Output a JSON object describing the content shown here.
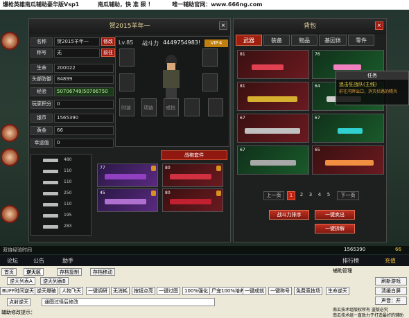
{
  "titlebar": {
    "app": "爆枪英雄南瓜辅助豪华版Vsp1",
    "slogan": "南瓜辅助，快 准 狠 ！",
    "site": "唯一辅助官网：www.666ng.com"
  },
  "character": {
    "title": "贺2015羊年一",
    "level": "Lv.85",
    "power_label": "战斗力",
    "power": "4449754983!",
    "vip": "VIP.4",
    "suit_button": "战袍套件",
    "stats": [
      {
        "label": "名称",
        "value": "贺2015羊年一",
        "action": "修改"
      },
      {
        "label": "称号",
        "value": "无",
        "action": "前往"
      },
      {
        "label": "生命",
        "value": "200022"
      },
      {
        "label": "头部防御",
        "value": "84899"
      },
      {
        "label": "经验",
        "value": "50706749/50706750"
      },
      {
        "label": "玩家积分",
        "value": "0"
      },
      {
        "label": "银币",
        "value": "1565390"
      },
      {
        "label": "黄金",
        "value": "66"
      },
      {
        "label": "幸运值",
        "value": "0"
      }
    ],
    "slot_labels": [
      "时装",
      "项链",
      "戒指"
    ],
    "weapon_counts": [
      "480",
      "110",
      "110",
      "250",
      "110",
      "195",
      "283"
    ],
    "weapons": [
      {
        "level": "77",
        "color": "purple"
      },
      {
        "level": "80",
        "color": "red"
      },
      {
        "level": "45",
        "color": "purple"
      },
      {
        "level": "80",
        "color": "red"
      }
    ]
  },
  "bag": {
    "title": "背包",
    "tabs": [
      "武器",
      "装备",
      "物品",
      "基因体",
      "零件"
    ],
    "active_tab": "武器",
    "items": [
      {
        "level": "81",
        "color": "red"
      },
      {
        "level": "76",
        "color": "green"
      },
      {
        "level": "81",
        "color": "red"
      },
      {
        "level": "64",
        "color": "green"
      },
      {
        "level": "67",
        "color": "red"
      },
      {
        "level": "67",
        "color": "green"
      },
      {
        "level": "67",
        "color": "green"
      },
      {
        "level": "65",
        "color": "red"
      }
    ],
    "prev": "上一页",
    "next": "下一页",
    "pages": [
      "1",
      "2",
      "3",
      "4",
      "5"
    ],
    "current_page": "1",
    "sort_button": "战斗力排序",
    "sell_button": "一键卖出",
    "dismantle_button": "一键拆解"
  },
  "task": {
    "title": "任务",
    "quest": "追击狂战队(主线)",
    "desc": "前往河畔出口，消灭拦路的精兵"
  },
  "hud": {
    "exp_label": "双倍经验时间",
    "silver": "1565390",
    "gold": "66",
    "nav": [
      "论坛",
      "公告",
      "助手",
      "排行榜",
      "充值"
    ]
  },
  "toolbar": {
    "tabs_row1": [
      "首页",
      "逆天区",
      "存档复制",
      "存档移动"
    ],
    "active_tab": "逆天区",
    "tabs_row2": [
      "逆天列表A",
      "逆天列表B"
    ],
    "buttons": [
      "BUFF时间逆天",
      "逆天爆破",
      "人物飞天",
      "一键调研",
      "无消耗",
      "按钮点亮",
      "一键过图",
      "100%强化",
      "尸宠100%培养",
      "一键成就",
      "一键称号",
      "免费竞技场",
      "生命逆天"
    ],
    "mode_label": "点射逆天",
    "mode_value": "通图过怪后修改",
    "hint_label": "辅助修改提示：",
    "side_title": "辅助管理",
    "side_buttons": [
      "刷新游戏",
      "清缓白屏",
      "声音：开"
    ],
    "copyright": "南瓜技术组版权所有 盗版必究",
    "copyright2": "南瓜技术组一直致力于打造最好的辅助"
  }
}
